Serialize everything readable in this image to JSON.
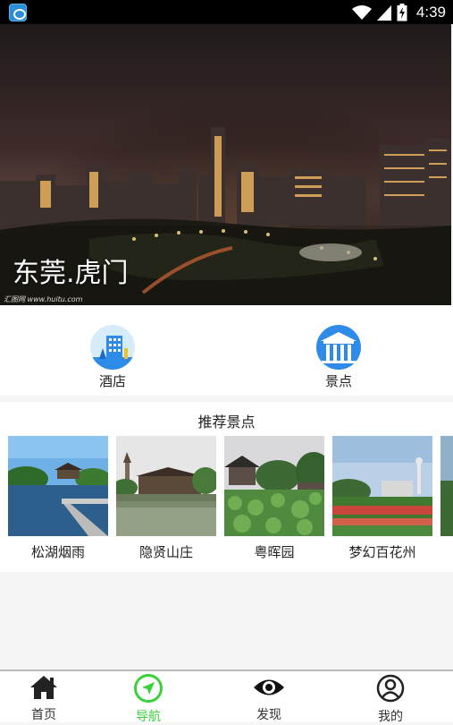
{
  "status_bar": {
    "time": "4:39",
    "icons": [
      "app-notification-icon",
      "wifi-icon",
      "signal-icon",
      "battery-icon"
    ]
  },
  "hero": {
    "title": "东莞.虎门",
    "watermark": "汇图网 www.huitu.com"
  },
  "categories": [
    {
      "label": "酒店",
      "icon": "hotel-building-icon"
    },
    {
      "label": "景点",
      "icon": "scenic-pavilion-icon"
    }
  ],
  "recommend": {
    "title": "推荐景点",
    "spots": [
      {
        "name": "松湖烟雨"
      },
      {
        "name": "隐贤山庄"
      },
      {
        "name": "粤晖园"
      },
      {
        "name": "梦幻百花州"
      }
    ]
  },
  "tabs": [
    {
      "label": "首页",
      "icon": "home-icon"
    },
    {
      "label": "导航",
      "icon": "navigation-icon",
      "active": true
    },
    {
      "label": "发现",
      "icon": "eye-icon"
    },
    {
      "label": "我的",
      "icon": "user-icon"
    }
  ],
  "colors": {
    "accent": "#3ad13a",
    "icon_blue": "#2f8be8"
  }
}
